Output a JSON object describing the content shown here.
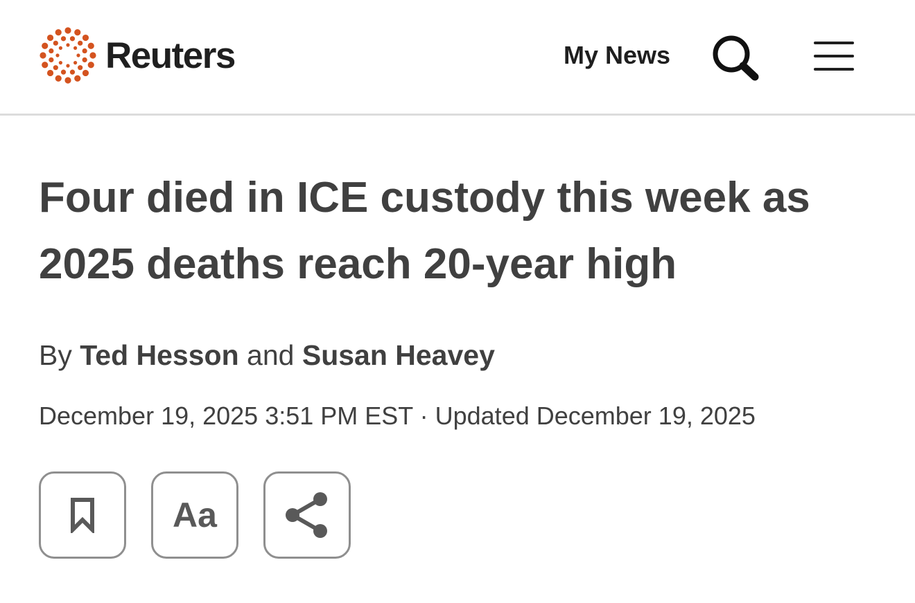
{
  "header": {
    "brand": "Reuters",
    "my_news": "My News",
    "icons": {
      "logo": "reuters-logo-icon",
      "search": "search-icon",
      "menu": "hamburger-menu-icon"
    },
    "colors": {
      "logo_orange": "#d4531f",
      "text_dark": "#1f1f1f",
      "divider": "#dcdcdc"
    }
  },
  "article": {
    "headline": "Four died in ICE custody this week as 2025 deaths reach 20-year high",
    "byline": {
      "prefix": "By",
      "author1": "Ted Hesson",
      "conjunction": "and",
      "author2": "Susan Heavey"
    },
    "dateline": "December 19, 2025 3:51 PM EST · Updated December 19, 2025",
    "text_color": "#404040"
  },
  "tools": {
    "font_size_label": "Aa",
    "icons": {
      "bookmark": "bookmark-icon",
      "share": "share-icon"
    },
    "border_color": "#8f8f8f",
    "icon_color": "#595959"
  }
}
